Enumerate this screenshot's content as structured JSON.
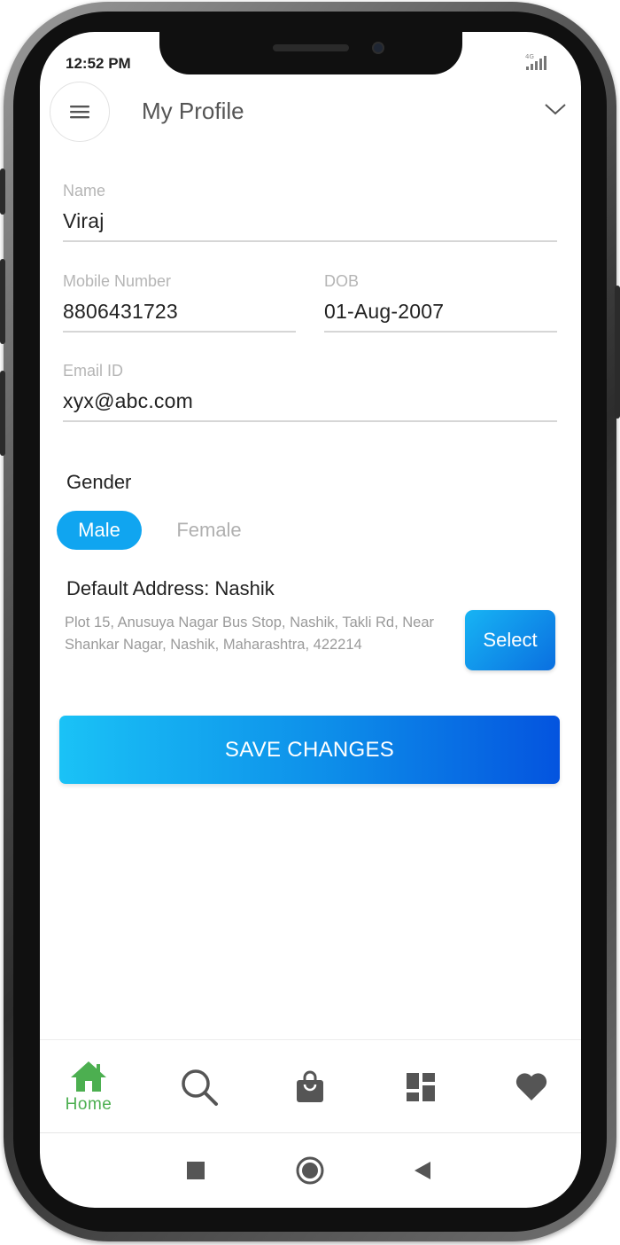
{
  "status_bar": {
    "time": "12:52 PM",
    "network": "4G"
  },
  "header": {
    "title": "My Profile",
    "menu_icon": "hamburger-icon",
    "dropdown_icon": "chevron-down-icon"
  },
  "form": {
    "name": {
      "label": "Name",
      "value": "Viraj"
    },
    "mobile": {
      "label": "Mobile Number",
      "value": "8806431723"
    },
    "dob": {
      "label": "DOB",
      "value": "01-Aug-2007"
    },
    "email": {
      "label": "Email ID",
      "value": "xyx@abc.com"
    }
  },
  "gender": {
    "label": "Gender",
    "options": [
      "Male",
      "Female"
    ],
    "selected": "Male"
  },
  "address": {
    "heading": "Default Address: Nashik",
    "text": "Plot 15, Anusuya Nagar Bus Stop, Nashik, Takli Rd, Near Shankar Nagar, Nashik, Maharashtra, 422214",
    "select_label": "Select"
  },
  "save_label": "SAVE CHANGES",
  "bottom_nav": {
    "items": [
      {
        "name": "home",
        "label": "Home",
        "icon": "home-icon",
        "active": true
      },
      {
        "name": "search",
        "label": "",
        "icon": "search-icon",
        "active": false
      },
      {
        "name": "bag",
        "label": "",
        "icon": "shopping-bag-icon",
        "active": false
      },
      {
        "name": "dashboard",
        "label": "",
        "icon": "dashboard-icon",
        "active": false
      },
      {
        "name": "favorites",
        "label": "",
        "icon": "heart-icon",
        "active": false
      }
    ]
  },
  "colors": {
    "accent": "#10a5f0",
    "gradient_start": "#1ac2f6",
    "gradient_end": "#0454df",
    "nav_active": "#4caf50",
    "nav_inactive": "#555555"
  }
}
